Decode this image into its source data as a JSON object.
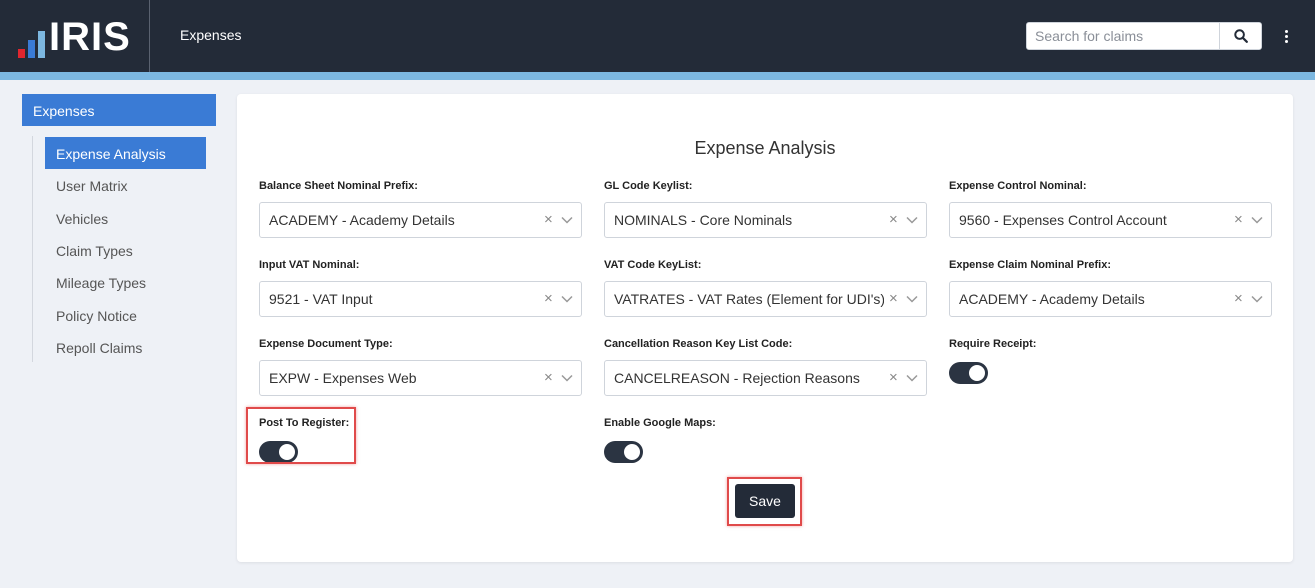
{
  "header": {
    "logo_text": "IRIS",
    "app_title": "Expenses",
    "search": {
      "placeholder": "Search for claims",
      "value": ""
    },
    "colors": {
      "bar": "#232b38",
      "accent": "#7cb7e0"
    }
  },
  "sidebar": {
    "heading": "Expenses",
    "items": [
      {
        "label": "Expense Analysis",
        "active": true
      },
      {
        "label": "User Matrix"
      },
      {
        "label": "Vehicles"
      },
      {
        "label": "Claim Types"
      },
      {
        "label": "Mileage Types"
      },
      {
        "label": "Policy Notice"
      },
      {
        "label": "Repoll Claims"
      }
    ]
  },
  "form": {
    "title": "Expense Analysis",
    "fields": [
      {
        "label": "Balance Sheet Nominal Prefix:",
        "value": "ACADEMY - Academy Details"
      },
      {
        "label": "GL Code Keylist:",
        "value": "NOMINALS - Core Nominals"
      },
      {
        "label": "Expense Control Nominal:",
        "value": "9560 - Expenses Control Account"
      },
      {
        "label": "Input VAT Nominal:",
        "value": "9521 - VAT Input"
      },
      {
        "label": "VAT Code KeyList:",
        "value": "VATRATES - VAT Rates (Element for UDI's)"
      },
      {
        "label": "Expense Claim Nominal Prefix:",
        "value": "ACADEMY - Academy Details"
      },
      {
        "label": "Expense Document Type:",
        "value": "EXPW - Expenses Web"
      },
      {
        "label": "Cancellation Reason Key List Code:",
        "value": "CANCELREASON - Rejection Reasons"
      }
    ],
    "toggles": [
      {
        "label": "Require Receipt:",
        "on": true
      },
      {
        "label": "Post To Register:",
        "on": true
      },
      {
        "label": "Enable Google Maps:",
        "on": true
      }
    ],
    "save_label": "Save"
  }
}
